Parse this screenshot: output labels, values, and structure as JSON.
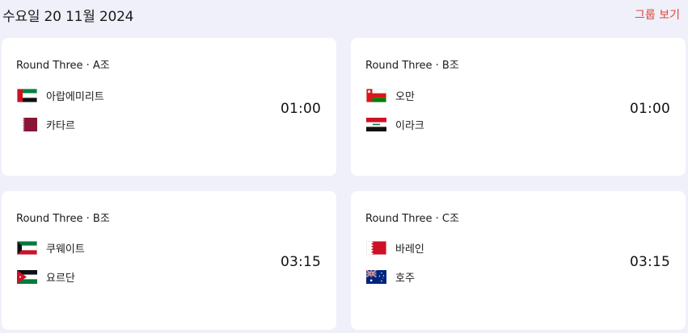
{
  "header": {
    "date": "수요일 20 11월 2024",
    "group_link": "그룹 보기"
  },
  "matches": [
    {
      "round": "Round Three · A조",
      "home": {
        "name": "아랍에미리트",
        "flag": "uae-flag"
      },
      "away": {
        "name": "카타르",
        "flag": "qatar-flag"
      },
      "time": "01:00"
    },
    {
      "round": "Round Three · B조",
      "home": {
        "name": "오만",
        "flag": "oman-flag"
      },
      "away": {
        "name": "이라크",
        "flag": "iraq-flag"
      },
      "time": "01:00"
    },
    {
      "round": "Round Three · B조",
      "home": {
        "name": "쿠웨이트",
        "flag": "kuwait-flag"
      },
      "away": {
        "name": "요르단",
        "flag": "jordan-flag"
      },
      "time": "03:15"
    },
    {
      "round": "Round Three · C조",
      "home": {
        "name": "바레인",
        "flag": "bahrain-flag"
      },
      "away": {
        "name": "호주",
        "flag": "australia-flag"
      },
      "time": "03:15"
    }
  ],
  "colors": {
    "background": "#eff0f9",
    "card": "#ffffff",
    "accent": "#e0453a"
  }
}
